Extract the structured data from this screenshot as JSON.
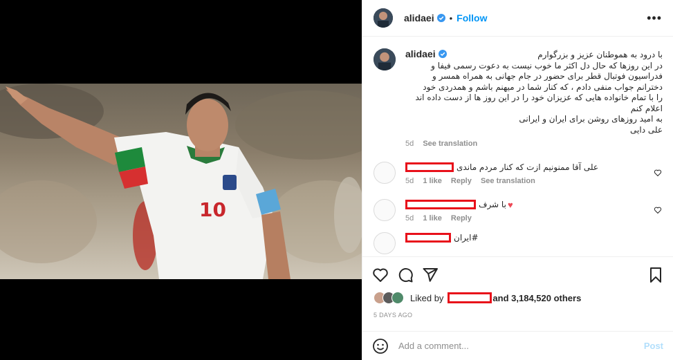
{
  "post": {
    "username": "alidaei",
    "follow_label": "Follow",
    "dot": "•",
    "more_label": "•••"
  },
  "caption": {
    "username": "alidaei",
    "lines": [
      "با درود به هموطنان عزیز و بزرگوارم",
      "در این روزها که حال دل اکثر ما خوب نیست به دعوت رسمی فیفا و",
      "فدراسیون فوتبال قطر برای حضور در جام جهانی به همراه همسر و",
      "دخترانم جواب منفی دادم ، که کنار شما در میهنم باشم و همدردی خود",
      "را با تمام خانواده هایی که عزیزان خود را در این روز ها از دست داده اند",
      "اعلام کنم",
      "به امید روزهای روشن برای ایران و ایرانی",
      "علی دایی"
    ],
    "age": "5d",
    "see_translation": "See translation"
  },
  "comments": [
    {
      "text": "علی آقا ممنونیم ازت که کنار مردم ماندی",
      "age": "5d",
      "likes": "1 like",
      "reply": "Reply",
      "see_translation": "See translation"
    },
    {
      "text": "با شرف",
      "emoji": "♥",
      "age": "5d",
      "likes": "1 like",
      "reply": "Reply"
    },
    {
      "text": "#ایران"
    }
  ],
  "likes": {
    "prefix": "Liked by",
    "suffix": "and 3,184,520 others"
  },
  "timestamp": "5 DAYS AGO",
  "add_comment": {
    "placeholder": "Add a comment...",
    "post_label": "Post"
  },
  "colors": {
    "accent": "#0095f6",
    "redaction": "#e8101a",
    "heart": "#ed4956",
    "muted": "#8e8e8e"
  },
  "icons": [
    "verified-badge-icon",
    "more-options-icon",
    "heart-icon",
    "comment-icon",
    "share-icon",
    "bookmark-icon",
    "emoji-icon"
  ]
}
